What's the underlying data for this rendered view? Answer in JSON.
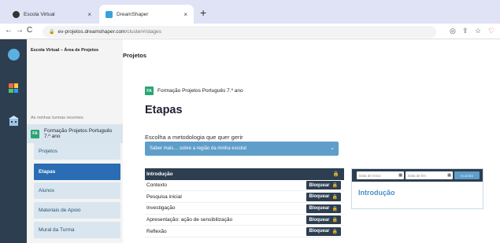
{
  "browser": {
    "tabs": [
      {
        "title": "Escola Virtual",
        "favicon_color": "#333333"
      },
      {
        "title": "DreamShaper",
        "favicon_color": "#3aa0e0"
      }
    ],
    "new_tab_icon": "+",
    "close_icon": "×",
    "url_host": "ev-projetos.dreamshaper.com",
    "url_path": "/cluster#/stages"
  },
  "sidebar": {
    "title": "Escola Virtual – Área de Projetos",
    "recent_label": "As minhas turmas recentes",
    "class_badge": "FA",
    "class_name": "Formação Projetos Português 7.º ano",
    "items": [
      {
        "label": "Projetos"
      },
      {
        "label": "Etapas"
      },
      {
        "label": "Alunos"
      },
      {
        "label": "Materiais de Apoio"
      },
      {
        "label": "Mural da Turma"
      }
    ]
  },
  "main": {
    "header": "Projetos",
    "breadcrumb_badge": "FA",
    "breadcrumb": "Formação Projetos Português 7.º ano",
    "title": "Etapas",
    "methodology_label": "Escolha a metodologia que quer gerir",
    "methodology_selected": "Saber mais… sobre a região da minha escola!",
    "block_label": "Bloquear",
    "stages": [
      {
        "name": "Introdução"
      },
      {
        "name": "Contexto"
      },
      {
        "name": "Pesquisa inicial"
      },
      {
        "name": "Investigação"
      },
      {
        "name": "Apresentação: ação de sensibilização"
      },
      {
        "name": "Reflexão"
      }
    ]
  },
  "panel": {
    "start_placeholder": "Data de início",
    "end_placeholder": "Data de fim",
    "save_label": "Guardar",
    "title": "Introdução"
  },
  "colors": {
    "accent": "#2a6db5",
    "dark": "#2d3e50",
    "select": "#5f9ec9",
    "badge": "#2aa572"
  }
}
